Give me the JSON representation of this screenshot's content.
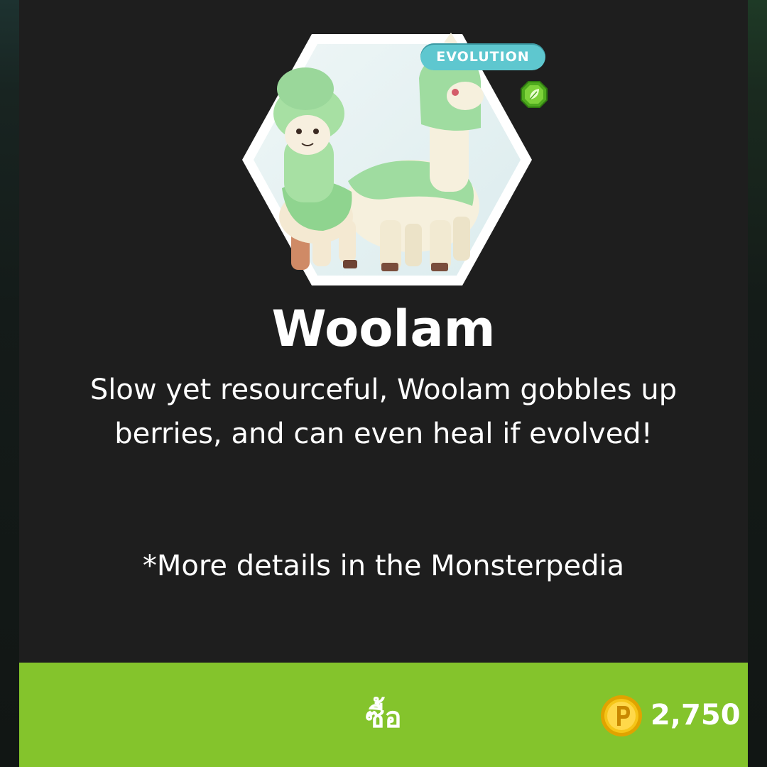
{
  "monster": {
    "name": "Woolam",
    "description": "Slow yet resourceful, Woolam gobbles up berries, and can even heal if evolved!",
    "note": "*More details in the Monsterpedia",
    "badge": "EVOLUTION",
    "element_icon": "leaf-gem-icon"
  },
  "purchase": {
    "label": "ซื้อ",
    "currency_icon": "p-coin-icon",
    "price": "2,750"
  },
  "colors": {
    "card_bg": "#1e1e1e",
    "buy_bar": "#84c42c",
    "badge": "#5ec7cf",
    "coin": "#f5c518"
  }
}
